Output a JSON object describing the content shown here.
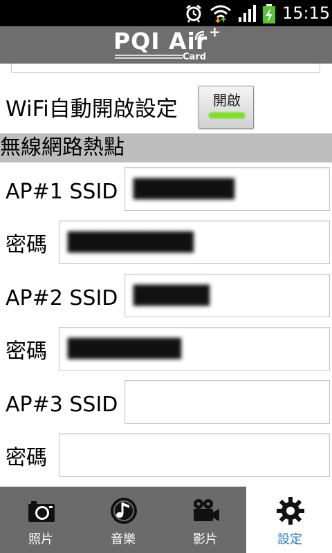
{
  "status_bar": {
    "time": "15:15",
    "icons": [
      "alarm-icon",
      "wifi-icon",
      "signal-icon",
      "battery-charging-icon"
    ]
  },
  "header": {
    "logo_text": "PQI Air",
    "logo_plus": "+",
    "logo_sub": "Card"
  },
  "wifi_auto": {
    "label": "WiFi自動開啟設定",
    "toggle_label": "開啟",
    "toggle_on": true,
    "indicator_color": "#7fe02a"
  },
  "hotspot": {
    "title": "無線網路熱點",
    "aps": [
      {
        "ssid_label": "AP#1 SSID",
        "ssid_value": "████████",
        "password_label": "密碼",
        "password_value": "██████████"
      },
      {
        "ssid_label": "AP#2 SSID",
        "ssid_value": "██████",
        "password_label": "密碼",
        "password_value": "█████████"
      },
      {
        "ssid_label": "AP#3 SSID",
        "ssid_value": "",
        "password_label": "密碼",
        "password_value": ""
      }
    ]
  },
  "bottom_nav": {
    "items": [
      {
        "label": "照片",
        "icon": "camera-icon",
        "active": false
      },
      {
        "label": "音樂",
        "icon": "music-icon",
        "active": false
      },
      {
        "label": "影片",
        "icon": "video-camera-icon",
        "active": false
      },
      {
        "label": "設定",
        "icon": "gear-icon",
        "active": true
      }
    ],
    "active_color": "#2a7ad5"
  }
}
